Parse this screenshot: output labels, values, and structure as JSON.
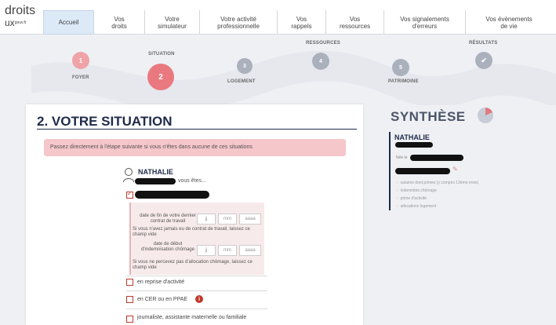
{
  "logo": {
    "line1": "droits",
    "line2": "ux",
    "suffix": "gouv.fr"
  },
  "nav": [
    {
      "label": "Accueil",
      "active": true
    },
    {
      "label": "Vos\ndroits"
    },
    {
      "label": "Votre\nsimulateur"
    },
    {
      "label": "Votre activité\nprofessionnelle"
    },
    {
      "label": "Vos\nrappels"
    },
    {
      "label": "Vos\nressources"
    },
    {
      "label": "Vos signalements\nd'erreurs"
    },
    {
      "label": "Vos évènements\nde vie"
    }
  ],
  "stepper": {
    "steps": [
      {
        "number": "1",
        "label": "FOYER",
        "state": "done"
      },
      {
        "number": "2",
        "label": "SITUATION",
        "state": "current"
      },
      {
        "number": "3",
        "label": "LOGEMENT",
        "state": "todo"
      },
      {
        "number": "4",
        "label": "RESSOURCES",
        "state": "todo"
      },
      {
        "number": "5",
        "label": "PATRIMOINE",
        "state": "todo"
      },
      {
        "number": "✔",
        "label": "RÉSULTATS",
        "state": "result"
      }
    ],
    "colors": {
      "done": "#f0a3a7",
      "current": "#e9797f",
      "todo": "#aab1bd",
      "result": "#aab1bd"
    }
  },
  "main": {
    "title": "2. VOTRE SITUATION",
    "alert": "Passez directement à l'étape suivante si vous n'êtes dans aucune de ces situations",
    "person_name": "NATHALIE",
    "vous_etes": "vous êtes...",
    "contract_end": {
      "label": "date de fin de votre dernier contrat de travail",
      "hint": "Si vous n'avez jamais eu de contrat de travail, laissez ce champ vide",
      "placeholders": [
        "jj",
        "mm",
        "aaaa"
      ]
    },
    "indemnisation_start": {
      "label": "date de début d'indemnisation chômage",
      "hint": "Si vous ne percevez pas d'allocation chômage, laissez ce champ vide",
      "placeholders": [
        "jj",
        "mm",
        "aaaa"
      ]
    },
    "options": [
      {
        "label": "en reprise d'activité",
        "checked": false
      },
      {
        "label": "en CER ou en PPAE",
        "checked": false,
        "info": "i"
      },
      {
        "label": "journaliste, assistante maternelle ou familiale",
        "checked": false
      }
    ]
  },
  "synthese": {
    "title": "SYNTHÈSE",
    "name": "NATHALIE",
    "born_prefix": "Née le",
    "items": [
      "salaires dont primes (y compris 13ème mois)",
      "indemnités chômage",
      "prime d'activité",
      "allocations logement"
    ]
  },
  "colors": {
    "accent": "#e9797f",
    "navy": "#1f2a4a",
    "alert_bg": "#f5c6ca"
  }
}
